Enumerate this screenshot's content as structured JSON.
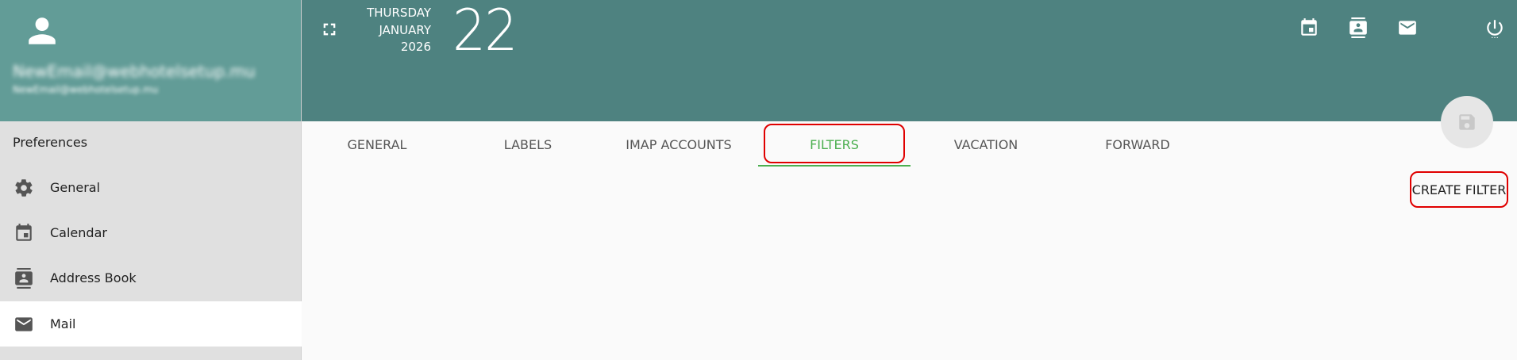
{
  "user": {
    "email": "NewEmail@webhotelsetup.mu",
    "sub": "NewEmail@webhotelsetup.mu"
  },
  "sidebar": {
    "title": "Preferences",
    "items": [
      {
        "label": "General",
        "icon": "gear-icon"
      },
      {
        "label": "Calendar",
        "icon": "calendar-icon"
      },
      {
        "label": "Address Book",
        "icon": "contacts-icon"
      },
      {
        "label": "Mail",
        "icon": "mail-icon",
        "active": true
      }
    ]
  },
  "header": {
    "weekday": "THURSDAY",
    "month": "JANUARY",
    "year": "2026",
    "day": "22",
    "icons": [
      "calendar-icon",
      "contacts-icon",
      "mail-icon",
      "power-icon"
    ]
  },
  "tabs": [
    {
      "label": "GENERAL"
    },
    {
      "label": "LABELS"
    },
    {
      "label": "IMAP ACCOUNTS"
    },
    {
      "label": "FILTERS",
      "active": true
    },
    {
      "label": "VACATION"
    },
    {
      "label": "FORWARD"
    }
  ],
  "actions": {
    "create_filter": "CREATE FILTER"
  },
  "colors": {
    "header_bg": "#4e8280",
    "user_bg": "#629c97",
    "accent": "#4caf50",
    "highlight": "#e00000"
  }
}
